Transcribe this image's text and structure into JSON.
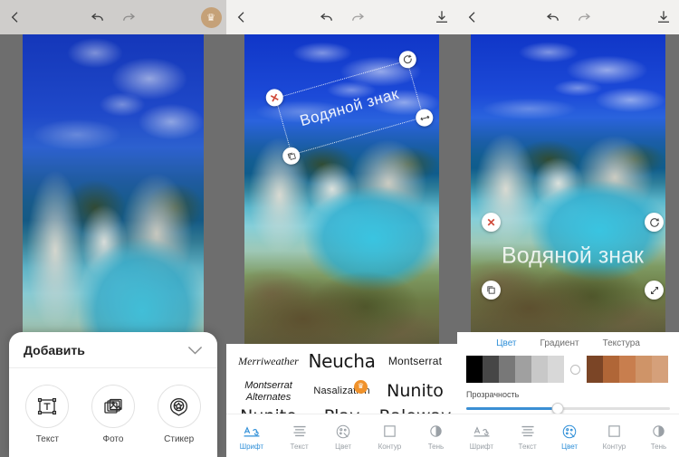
{
  "app": {
    "language": "ru",
    "accent_color": "#2f8fd8",
    "premium_color": "#f0922b"
  },
  "panel1": {
    "name": "add-object-panel",
    "topbar": {
      "back_icon": "chevron-left-icon",
      "undo_icon": "undo-icon",
      "redo_icon": "redo-icon",
      "premium_icon": "crown-icon"
    },
    "sheet": {
      "title": "Добавить",
      "collapse_icon": "chevron-down-icon",
      "items": [
        {
          "label": "Текст",
          "icon": "text-box-icon"
        },
        {
          "label": "Фото",
          "icon": "photo-stack-icon"
        },
        {
          "label": "Стикер",
          "icon": "sticker-badge-icon"
        }
      ]
    }
  },
  "panel2": {
    "name": "font-picker-panel",
    "topbar": {
      "back_icon": "chevron-left-icon",
      "undo_icon": "undo-icon",
      "redo_icon": "redo-icon",
      "download_icon": "download-icon"
    },
    "watermark": {
      "text": "Водяной знак",
      "rotation_deg": -16,
      "handles": [
        {
          "position": "top-left",
          "icon": "close-icon",
          "glyph": "✕"
        },
        {
          "position": "top-right",
          "icon": "rotate-icon",
          "glyph": "⟳"
        },
        {
          "position": "bottom-left",
          "icon": "duplicate-icon",
          "glyph": "❐"
        },
        {
          "position": "bottom-right",
          "icon": "resize-icon",
          "glyph": "↔"
        }
      ]
    },
    "fonts": [
      {
        "name": "Merriweather",
        "premium": false
      },
      {
        "name": "Neucha",
        "premium": false
      },
      {
        "name": "Montserrat",
        "premium": false
      },
      {
        "name": "Montserrat Alternates",
        "line1": "Montserrat",
        "line2": "Alternates",
        "premium": false
      },
      {
        "name": "Nasalization",
        "premium": true
      },
      {
        "name": "Nunito",
        "premium": false
      }
    ],
    "fonts_row3": [
      "Nunito",
      "Play",
      "Raleway"
    ],
    "toolbar": [
      {
        "label": "Шрифт",
        "icon": "font-aa-icon",
        "active": true
      },
      {
        "label": "Текст",
        "icon": "align-lines-icon",
        "active": false
      },
      {
        "label": "Цвет",
        "icon": "palette-icon",
        "active": false
      },
      {
        "label": "Контур",
        "icon": "square-outline-icon",
        "active": false
      },
      {
        "label": "Тень",
        "icon": "half-circle-shadow-icon",
        "active": false
      }
    ]
  },
  "panel3": {
    "name": "color-picker-panel",
    "topbar": {
      "back_icon": "chevron-left-icon",
      "undo_icon": "undo-icon",
      "redo_icon": "redo-icon",
      "download_icon": "download-icon"
    },
    "watermark": {
      "text": "Водяной знак",
      "handles": [
        {
          "position": "top-left",
          "icon": "close-icon",
          "glyph": "✕"
        },
        {
          "position": "top-right",
          "icon": "rotate-icon",
          "glyph": "⟳"
        },
        {
          "position": "bottom-left",
          "icon": "duplicate-icon",
          "glyph": "❐"
        },
        {
          "position": "bottom-right",
          "icon": "resize-icon",
          "glyph": "⤢"
        }
      ]
    },
    "color_tabs": [
      {
        "label": "Цвет",
        "active": true
      },
      {
        "label": "Градиент",
        "active": false
      },
      {
        "label": "Текстура",
        "active": false
      }
    ],
    "swatches_gray": [
      "#000000",
      "#464646",
      "#787878",
      "#a0a0a0",
      "#c8c8c8"
    ],
    "picker_icon": "color-wheel-circle-icon",
    "swatches_brown": [
      "#7b4526",
      "#b06637",
      "#c87e4e",
      "#cf9468"
    ],
    "opacity": {
      "label": "Прозрачность",
      "value_percent": 45
    },
    "toolbar": [
      {
        "label": "Шрифт",
        "icon": "font-aa-icon",
        "active": false
      },
      {
        "label": "Текст",
        "icon": "align-lines-icon",
        "active": false
      },
      {
        "label": "Цвет",
        "icon": "palette-icon",
        "active": true
      },
      {
        "label": "Контур",
        "icon": "square-outline-icon",
        "active": false
      },
      {
        "label": "Тень",
        "icon": "half-circle-shadow-icon",
        "active": false
      }
    ]
  }
}
